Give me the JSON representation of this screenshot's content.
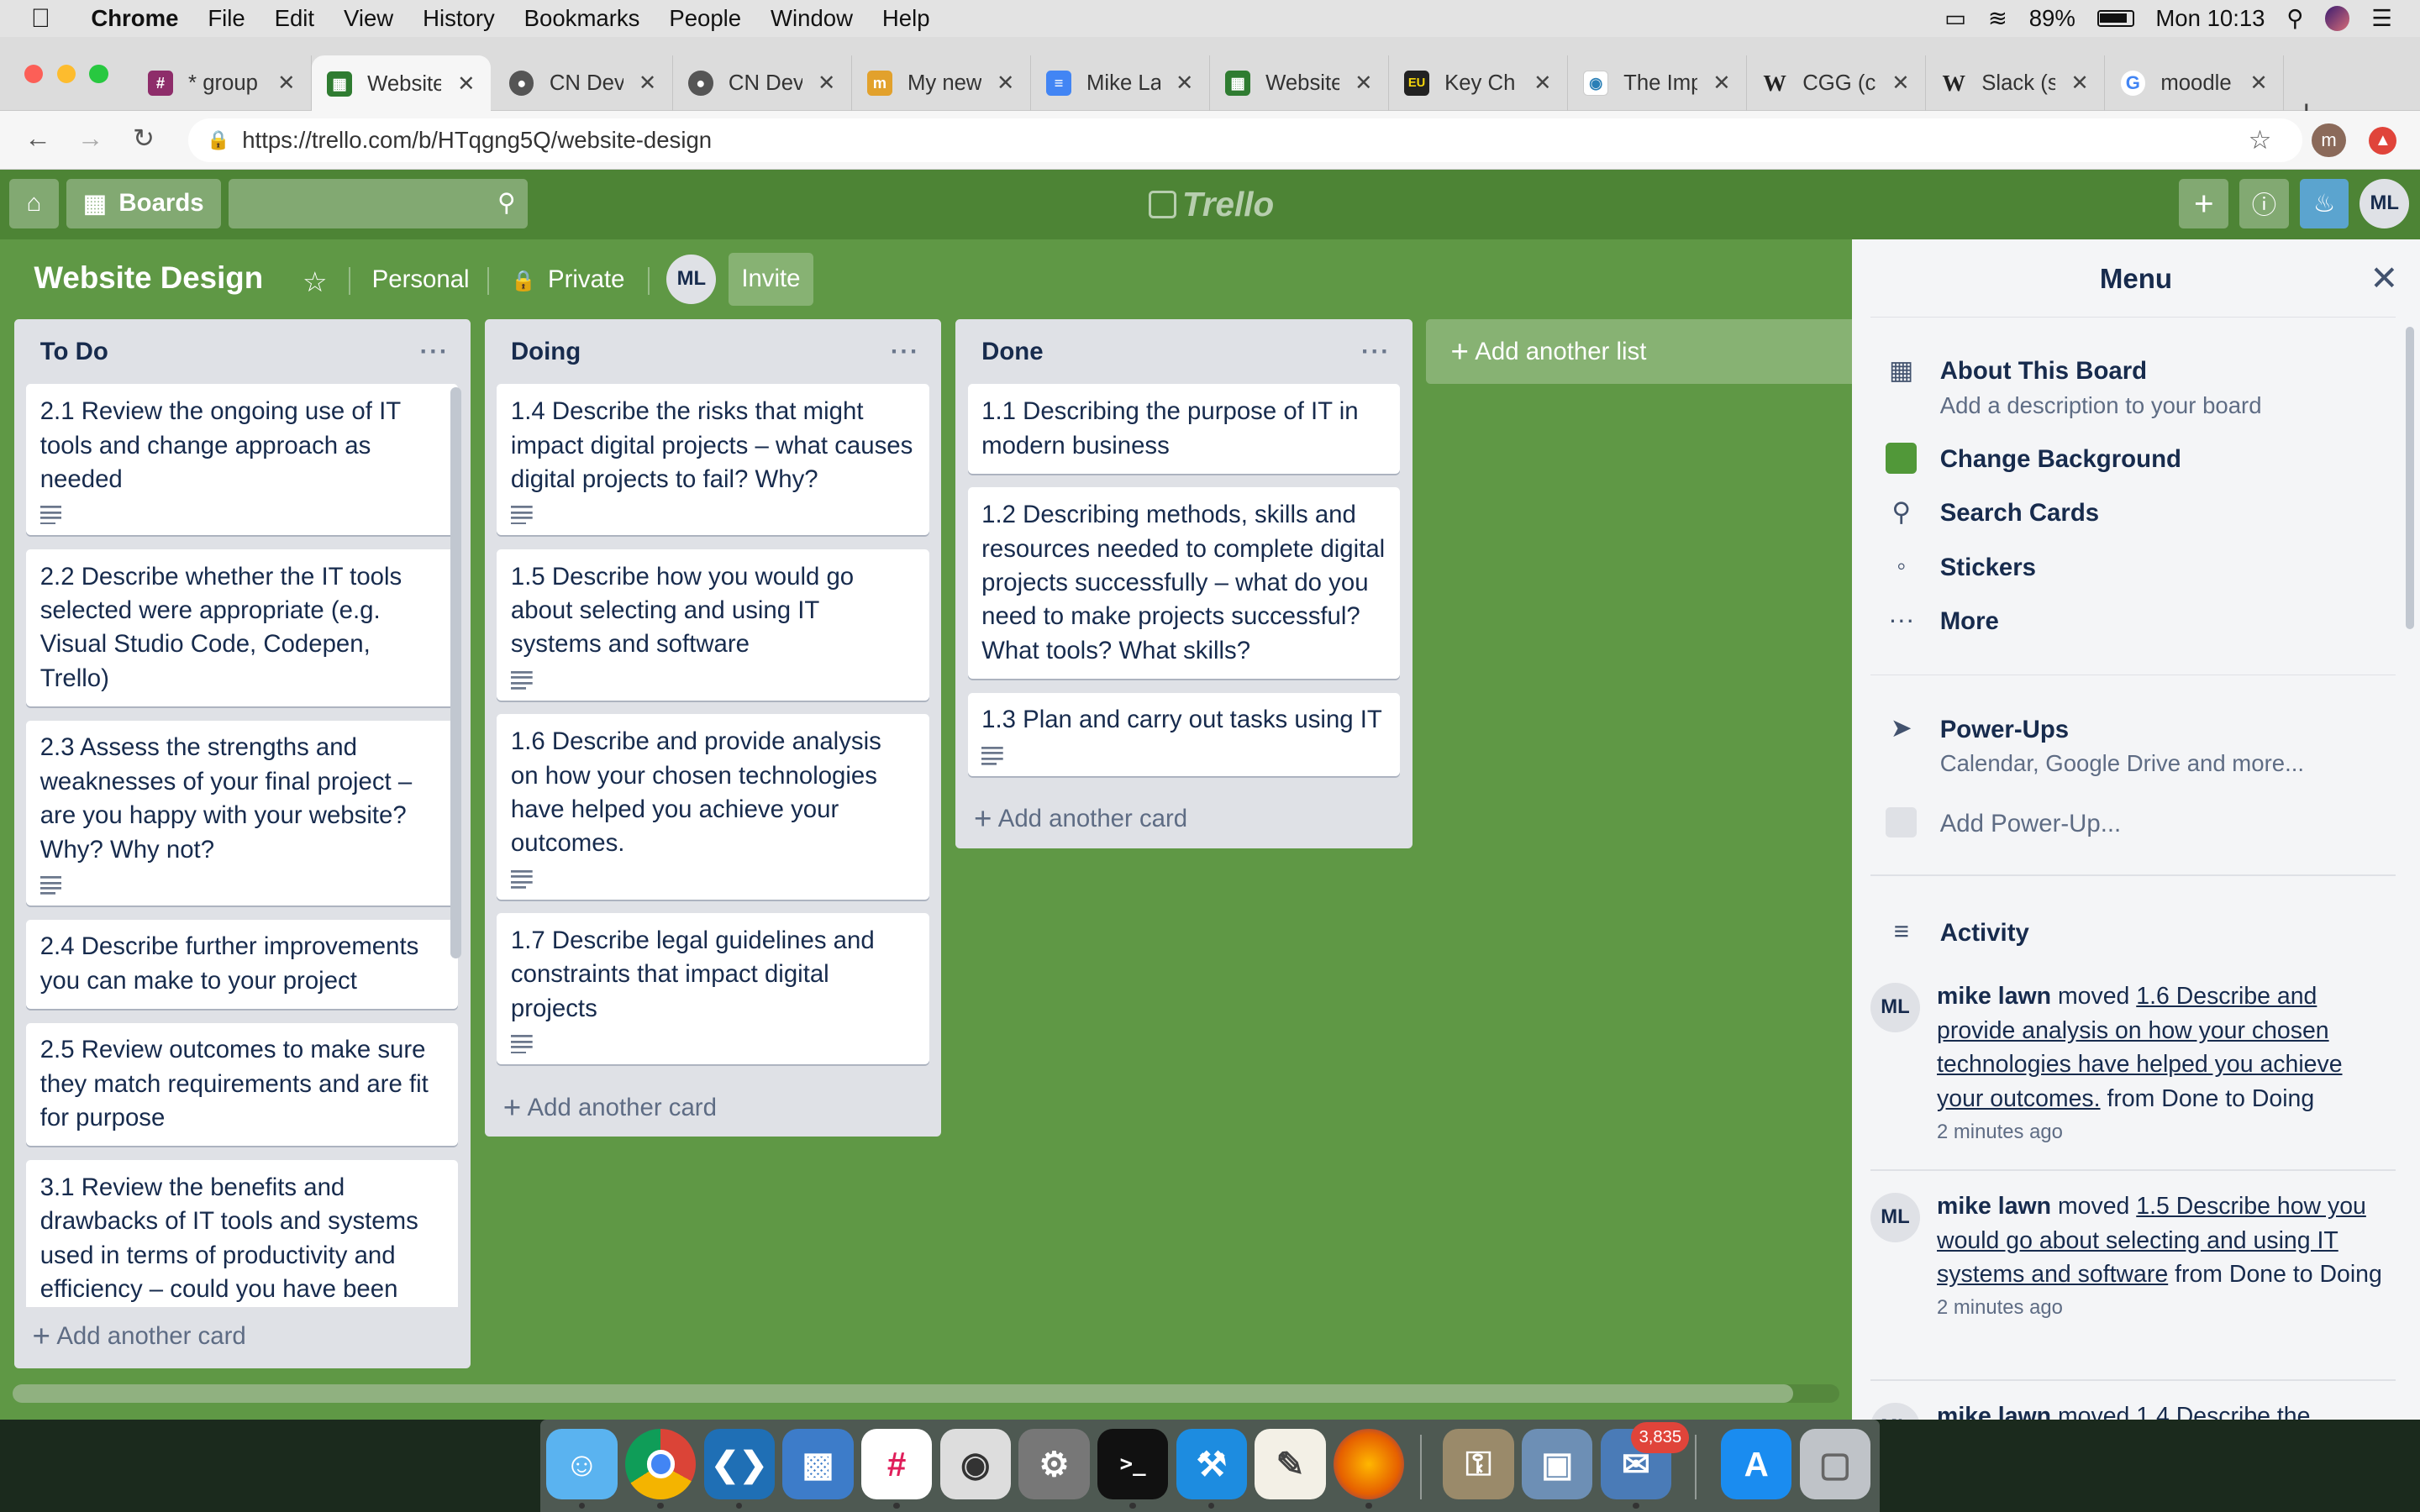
{
  "macos": {
    "app_name": "Chrome",
    "menus": [
      "File",
      "Edit",
      "View",
      "History",
      "Bookmarks",
      "People",
      "Window",
      "Help"
    ],
    "battery": "89%",
    "clock": "Mon 10:13"
  },
  "browser": {
    "tabs": [
      {
        "title": "* group",
        "favicon": "purple-app-icon"
      },
      {
        "title": "Website",
        "favicon": "trello-icon",
        "active": true
      },
      {
        "title": "CN Dev",
        "favicon": "globe-icon"
      },
      {
        "title": "CN Dev",
        "favicon": "globe-icon"
      },
      {
        "title": "My new",
        "favicon": "app-icon"
      },
      {
        "title": "Mike La",
        "favicon": "docs-icon"
      },
      {
        "title": "Website",
        "favicon": "trello-icon"
      },
      {
        "title": "Key Ch",
        "favicon": "eu-gdpr-icon"
      },
      {
        "title": "The Imp",
        "favicon": "eye-icon"
      },
      {
        "title": "CGG (c",
        "favicon": "wikipedia-icon"
      },
      {
        "title": "Slack (s",
        "favicon": "wikipedia-icon"
      },
      {
        "title": "moodle",
        "favicon": "google-icon"
      }
    ],
    "url": "https://trello.com/b/HTqgng5Q/website-design",
    "profile_initial": "m"
  },
  "trello": {
    "boards_label": "Boards",
    "logo_text": "Trello",
    "user_initials": "ML"
  },
  "board": {
    "title": "Website Design",
    "team": "Personal",
    "visibility": "Private",
    "member_initials": "ML",
    "invite_label": "Invite",
    "add_list_label": "Add another list",
    "lists": [
      {
        "name": "To Do",
        "cards": [
          {
            "text": "2.1 Review the ongoing use of IT tools and change approach as needed",
            "has_desc": true
          },
          {
            "text": "2.2 Describe whether the IT tools selected were appropriate (e.g. Visual Studio Code, Codepen, Trello)",
            "has_desc": false
          },
          {
            "text": "2.3 Assess the strengths and weaknesses of your final project – are you happy with your website? Why? Why not?",
            "has_desc": true
          },
          {
            "text": "2.4 Describe further improvements you can make to your project",
            "has_desc": false
          },
          {
            "text": "2.5 Review outcomes to make sure they match requirements and are fit for purpose",
            "has_desc": false
          },
          {
            "text": "3.1 Review the benefits and drawbacks of IT tools and systems used in terms of productivity and efficiency – could you have been",
            "has_desc": false
          }
        ],
        "add_card_label": "Add another card"
      },
      {
        "name": "Doing",
        "cards": [
          {
            "text": "1.4 Describe the risks that might impact digital projects – what causes digital projects to fail? Why?",
            "has_desc": true
          },
          {
            "text": "1.5 Describe how you would go about selecting and using IT systems and software",
            "has_desc": true
          },
          {
            "text": "1.6 Describe and provide analysis on how your chosen technologies have helped you achieve your outcomes.",
            "has_desc": true
          },
          {
            "text": "1.7 Describe legal guidelines and constraints that impact digital projects",
            "has_desc": true
          }
        ],
        "add_card_label": "Add another card"
      },
      {
        "name": "Done",
        "cards": [
          {
            "text": "1.1 Describing the purpose of IT in modern business",
            "has_desc": false
          },
          {
            "text": "1.2 Describing methods, skills and resources needed to complete digital projects successfully – what do you need to make projects successful? What tools? What skills?",
            "has_desc": false
          },
          {
            "text": "1.3 Plan and carry out tasks using IT",
            "has_desc": true
          }
        ],
        "add_card_label": "Add another card"
      }
    ]
  },
  "menu": {
    "title": "Menu",
    "about_title": "About This Board",
    "about_sub": "Add a description to your board",
    "change_bg": "Change Background",
    "bg_color": "#519839",
    "search_cards": "Search Cards",
    "stickers": "Stickers",
    "more": "More",
    "powerups_title": "Power-Ups",
    "powerups_sub": "Calendar, Google Drive and more...",
    "add_powerup": "Add Power-Up...",
    "activity_title": "Activity",
    "activity": [
      {
        "initials": "ML",
        "user": "mike lawn",
        "verb": "moved",
        "card": "1.6 Describe and provide analysis on how your chosen technologies have helped you achieve your outcomes.",
        "from_to": "from Done to Doing",
        "time": "2 minutes ago"
      },
      {
        "initials": "ML",
        "user": "mike lawn",
        "verb": "moved",
        "card": "1.5 Describe how you would go about selecting and using IT systems and software",
        "from_to": "from Done to Doing",
        "time": "2 minutes ago"
      },
      {
        "initials": "ML",
        "user": "mike lawn",
        "verb": "moved",
        "card": "1.4 Describe the",
        "from_to": "",
        "time": ""
      }
    ]
  },
  "dock": {
    "apps": [
      "Finder",
      "Chrome",
      "Visual Studio Code",
      "Keynote",
      "Slack",
      "Screenshot",
      "System Preferences",
      "Terminal",
      "Xcode",
      "TextEdit",
      "Firefox",
      "Keychain Access",
      "Preview",
      "Mail",
      "App Store",
      "Trash"
    ],
    "mail_badge": "3,835"
  }
}
